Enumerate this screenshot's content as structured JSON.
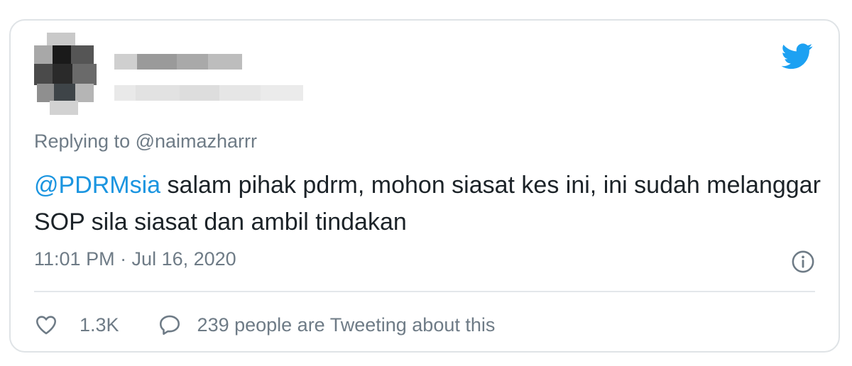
{
  "tweet": {
    "replying_to": "Replying to @naimazharrr",
    "mention": "@PDRMsia",
    "text": " salam pihak pdrm, mohon siasat kes ini, ini sudah melanggar SOP sila siasat dan ambil tindakan",
    "timestamp": "11:01 PM · Jul 16, 2020"
  },
  "actions": {
    "like_count": "1.3K",
    "tweeting_text": "239 people are Tweeting about this"
  },
  "icons": {
    "brand": "twitter-bird-icon",
    "info": "info-icon",
    "like": "heart-icon",
    "reply": "speech-bubble-icon"
  },
  "colors": {
    "brand": "#1da1f2",
    "mention": "#1b95e0",
    "text": "#1c2328",
    "muted": "#6e7b86"
  }
}
